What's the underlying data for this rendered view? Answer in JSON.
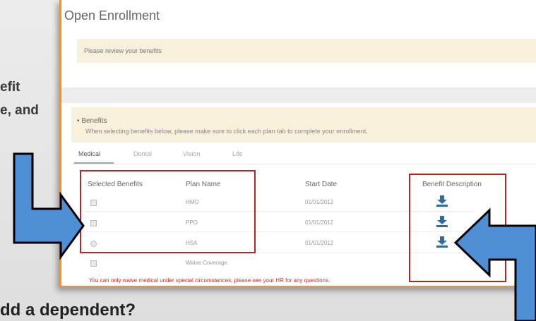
{
  "background": {
    "line1": "efit",
    "line2": "e, and",
    "bottom_heading": "dd a dependent?"
  },
  "window": {
    "title": "Open Enrollment",
    "notice": "Please review your benefits",
    "benefits_header": "Benefits",
    "benefits_instructions": "When selecting benefits below, please make sure to click each plan tab to complete your enrollment."
  },
  "tabs": [
    "Medical",
    "Dental",
    "Vision",
    "Life"
  ],
  "table": {
    "headers": {
      "selected": "Selected Benefits",
      "plan": "Plan Name",
      "start": "Start Date",
      "description": "Benefit Description"
    },
    "rows": [
      {
        "plan": "HMO",
        "start": "01/01/2012",
        "type": "checkbox"
      },
      {
        "plan": "PPO",
        "start": "01/01/2012",
        "type": "checkbox"
      },
      {
        "plan": "HSA",
        "start": "01/01/2012",
        "type": "radio"
      },
      {
        "plan": "Waive Coverage",
        "start": "",
        "type": "checkbox"
      }
    ]
  },
  "warning": "You can only waive medical under special circumstances, please see your HR for any questions.",
  "colors": {
    "accent_border": "#e0954a",
    "highlight_box": "#bb2222",
    "arrow_fill": "#4f8fd6",
    "arrow_stroke": "#000000",
    "download_icon": "#2e6da4",
    "warning_text": "#dd2222"
  },
  "icons": {
    "download": "download-icon",
    "arrow_left": "callout-arrow-icon",
    "arrow_right": "callout-arrow-icon"
  }
}
